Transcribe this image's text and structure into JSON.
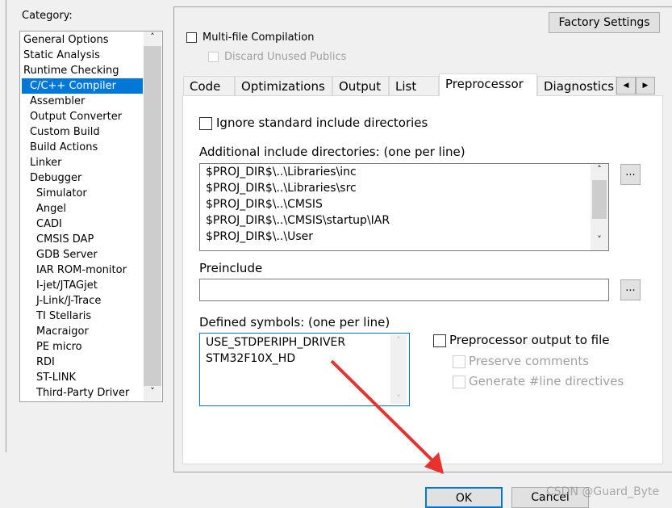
{
  "category": {
    "label": "Category:",
    "items": [
      {
        "label": "General Options",
        "indent": 0
      },
      {
        "label": "Static Analysis",
        "indent": 0
      },
      {
        "label": "Runtime Checking",
        "indent": 0
      },
      {
        "label": "C/C++ Compiler",
        "indent": 1,
        "selected": true
      },
      {
        "label": "Assembler",
        "indent": 1
      },
      {
        "label": "Output Converter",
        "indent": 1
      },
      {
        "label": "Custom Build",
        "indent": 1
      },
      {
        "label": "Build Actions",
        "indent": 1
      },
      {
        "label": "Linker",
        "indent": 1
      },
      {
        "label": "Debugger",
        "indent": 1
      },
      {
        "label": "Simulator",
        "indent": 2
      },
      {
        "label": "Angel",
        "indent": 2
      },
      {
        "label": "CADI",
        "indent": 2
      },
      {
        "label": "CMSIS DAP",
        "indent": 2
      },
      {
        "label": "GDB Server",
        "indent": 2
      },
      {
        "label": "IAR ROM-monitor",
        "indent": 2
      },
      {
        "label": "I-jet/JTAGjet",
        "indent": 2
      },
      {
        "label": "J-Link/J-Trace",
        "indent": 2
      },
      {
        "label": "TI Stellaris",
        "indent": 2
      },
      {
        "label": "Macraigor",
        "indent": 2
      },
      {
        "label": "PE micro",
        "indent": 2
      },
      {
        "label": "RDI",
        "indent": 2
      },
      {
        "label": "ST-LINK",
        "indent": 2
      },
      {
        "label": "Third-Party Driver",
        "indent": 2
      }
    ]
  },
  "factory_settings": "Factory Settings",
  "multi_file": {
    "label": "Multi-file Compilation",
    "checked": false
  },
  "discard_unused": {
    "label": "Discard Unused Publics",
    "checked": false,
    "disabled": true
  },
  "tabs": [
    {
      "label": "Code"
    },
    {
      "label": "Optimizations"
    },
    {
      "label": "Output"
    },
    {
      "label": "List"
    },
    {
      "label": "Preprocessor",
      "active": true
    },
    {
      "label": "Diagnostics"
    }
  ],
  "ignore_std": {
    "label": "Ignore standard include directories",
    "checked": false
  },
  "additional_include": {
    "label": "Additional include directories: (one per line)",
    "lines": [
      "$PROJ_DIR$\\..\\Libraries\\inc",
      "$PROJ_DIR$\\..\\Libraries\\src",
      "$PROJ_DIR$\\..\\CMSIS",
      "$PROJ_DIR$\\..\\CMSIS\\startup\\IAR",
      "$PROJ_DIR$\\..\\User"
    ]
  },
  "preinclude": {
    "label": "Preinclude",
    "value": ""
  },
  "browse_label": "...",
  "defined_symbols": {
    "label": "Defined symbols: (one per line)",
    "lines": [
      "USE_STDPERIPH_DRIVER",
      "STM32F10X_HD"
    ]
  },
  "pp_output": {
    "label": "Preprocessor output to file",
    "checked": false
  },
  "preserve_comments": {
    "label": "Preserve comments",
    "checked": false,
    "disabled": true
  },
  "generate_line": {
    "label": "Generate #line directives",
    "checked": false,
    "disabled": true
  },
  "ok": "OK",
  "cancel": "Cancel",
  "watermark": "CSDN @Guard_Byte",
  "arrow_color": "#e8322f"
}
